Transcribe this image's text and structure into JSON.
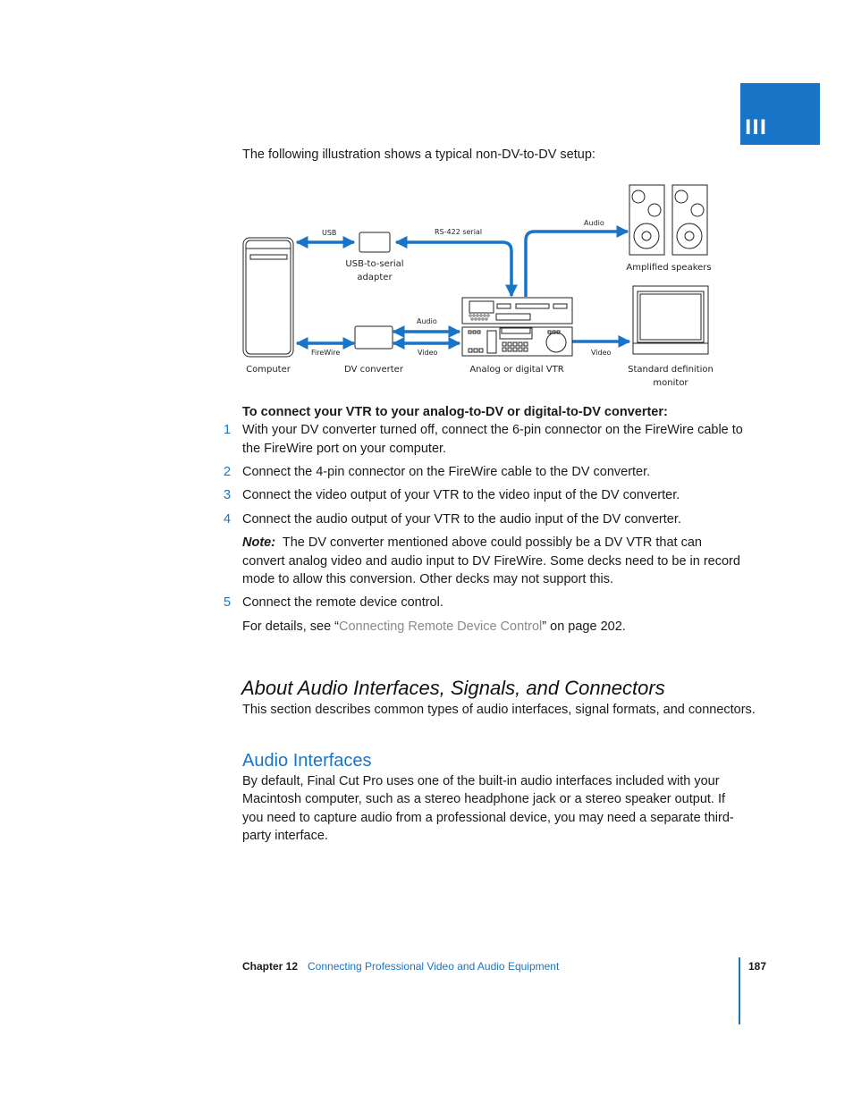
{
  "part_tab": {
    "label": "III",
    "color": "#1874c6"
  },
  "intro": "The following illustration shows a typical non-DV-to-DV setup:",
  "diagram": {
    "devices": {
      "computer": "Computer",
      "usb_adapter": [
        "USB-to-serial",
        "adapter"
      ],
      "dv_converter": "DV converter",
      "vtr": "Analog or digital VTR",
      "speakers": "Amplified speakers",
      "monitor": [
        "Standard definition",
        "monitor"
      ]
    },
    "connections": {
      "usb": "USB",
      "rs422": "RS-422 serial",
      "firewire": "FireWire",
      "audio_converter": "Audio",
      "video_converter": "Video",
      "audio_speakers": "Audio",
      "video_monitor": "Video"
    },
    "cable_color": "#1874c6"
  },
  "procedure": {
    "heading": "To connect your VTR to your analog-to-DV or digital-to-DV converter:",
    "steps": [
      {
        "num": "1",
        "text": "With your DV converter turned off, connect the 6-pin connector on the FireWire cable to the FireWire port on your computer."
      },
      {
        "num": "2",
        "text": "Connect the 4-pin connector on the FireWire cable to the DV converter."
      },
      {
        "num": "3",
        "text": "Connect the video output of your VTR to the video input of the DV converter."
      },
      {
        "num": "4",
        "text": "Connect the audio output of your VTR to the audio input of the DV converter."
      }
    ],
    "note_label": "Note:",
    "note_text": "The DV converter mentioned above could possibly be a DV VTR that can convert analog video and audio input to DV FireWire. Some decks need to be in record mode to allow this conversion. Other decks may not support this.",
    "step5": {
      "num": "5",
      "text": "Connect the remote device control."
    },
    "details_prefix": "For details, see “",
    "details_link": "Connecting Remote Device Control",
    "details_suffix": "” on page 202."
  },
  "section": {
    "title": "About Audio Interfaces, Signals, and Connectors",
    "description": "This section describes common types of audio interfaces, signal formats, and connectors."
  },
  "subsection": {
    "title": "Audio Interfaces",
    "body": "By default, Final Cut Pro uses one of the built-in audio interfaces included with your Macintosh computer, such as a stereo headphone jack or a stereo speaker output. If you need to capture audio from a professional device, you may need a separate third-party interface."
  },
  "footer": {
    "chapter": "Chapter 12",
    "chapter_title": "Connecting Professional Video and Audio Equipment",
    "page": "187"
  }
}
